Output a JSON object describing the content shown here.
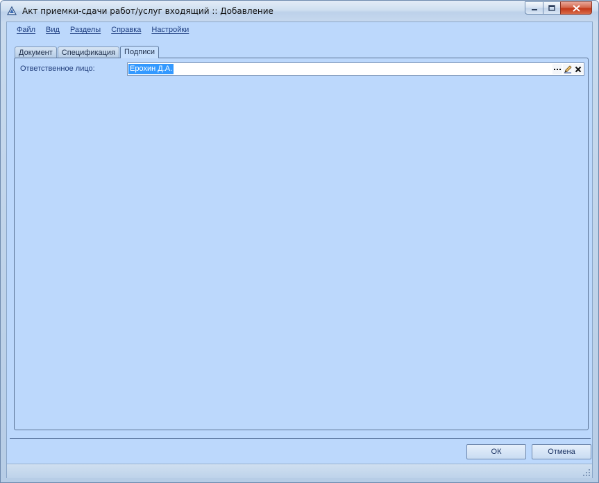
{
  "window": {
    "title": "Акт приемки-сдачи работ/услуг входящий :: Добавление",
    "icon": "app-logo-icon",
    "controls": {
      "minimize": "minimize-icon",
      "maximize": "maximize-icon",
      "close": "close-icon"
    }
  },
  "menu": [
    {
      "label": "Файл"
    },
    {
      "label": "Вид"
    },
    {
      "label": "Разделы"
    },
    {
      "label": "Справка"
    },
    {
      "label": "Настройки"
    }
  ],
  "tabs": [
    {
      "label": "Документ",
      "active": false
    },
    {
      "label": "Спецификация",
      "active": false
    },
    {
      "label": "Подписи",
      "active": true
    }
  ],
  "form": {
    "responsible_label": "Ответственное лицо:",
    "responsible_value": "Ерохин Д.А.",
    "field_buttons": [
      "ellipsis-icon",
      "edit-pencil-icon",
      "clear-x-icon"
    ]
  },
  "buttons": {
    "ok": "ОК",
    "cancel": "Отмена"
  },
  "colors": {
    "panel": "#bcd8fc",
    "selection": "#3399ff",
    "close_button": "#c3391a"
  }
}
